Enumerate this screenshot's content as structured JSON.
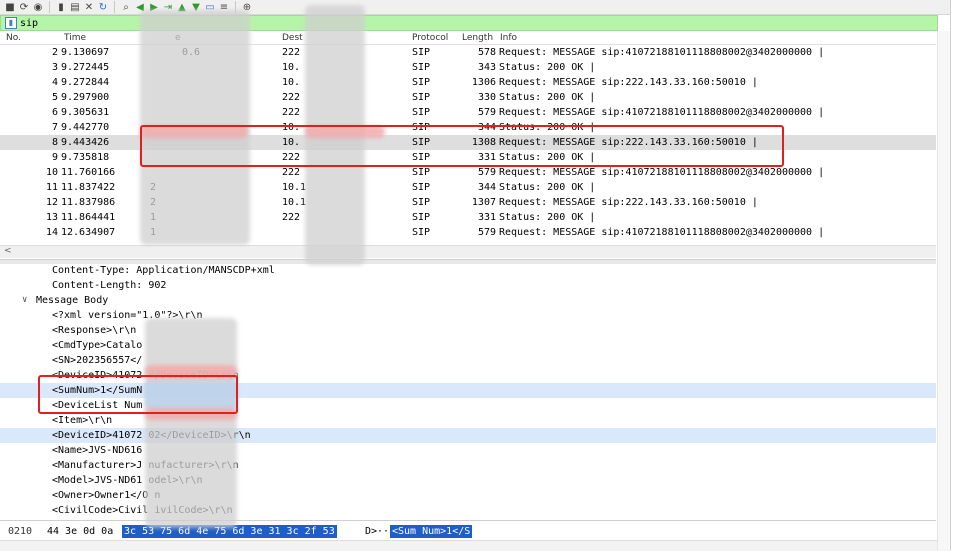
{
  "toolbar": {
    "icons": [
      "stop-icon",
      "restart-icon",
      "options-icon",
      "open-icon",
      "save-icon",
      "close-file-icon",
      "reload-icon",
      "find-icon",
      "back-icon",
      "forward-icon",
      "goto-icon",
      "first-icon",
      "last-icon",
      "autoscroll-icon",
      "colorize-icon",
      "zoom-in-icon"
    ]
  },
  "filter": {
    "value": "sip"
  },
  "columns": {
    "no": "No.",
    "time": "Time",
    "source": "e",
    "destination": "Dest",
    "protocol": "Protocol",
    "length": "Length",
    "info": "Info"
  },
  "packets": [
    {
      "no": "2",
      "time": "9.130697",
      "src": "0.6",
      "dst": "222",
      "proto": "SIP",
      "len": "578",
      "info": "Request: MESSAGE sip:41072188101118808002@3402000000 |"
    },
    {
      "no": "3",
      "time": "9.272445",
      "src": "",
      "dst": "10.",
      "proto": "SIP",
      "len": "343",
      "info": "Status: 200 OK |"
    },
    {
      "no": "4",
      "time": "9.272844",
      "src": "",
      "dst": "10.",
      "proto": "SIP",
      "len": "1306",
      "info": "Request: MESSAGE sip:222.143.33.160:50010 |"
    },
    {
      "no": "5",
      "time": "9.297900",
      "src": "",
      "dst": "222",
      "proto": "SIP",
      "len": "330",
      "info": "Status: 200 OK |"
    },
    {
      "no": "6",
      "time": "9.305631",
      "src": "",
      "dst": "222",
      "proto": "SIP",
      "len": "579",
      "info": "Request: MESSAGE sip:41072188101118808002@3402000000 |"
    },
    {
      "no": "7",
      "time": "9.442770",
      "src": "",
      "dst": "10.",
      "proto": "SIP",
      "len": "344",
      "info": "Status: 200 OK |"
    },
    {
      "no": "8",
      "time": "9.443426",
      "src": "",
      "dst": "10.",
      "proto": "SIP",
      "len": "1308",
      "info": "Request: MESSAGE sip:222.143.33.160:50010 |"
    },
    {
      "no": "9",
      "time": "9.735818",
      "src": "",
      "dst": "222",
      "proto": "SIP",
      "len": "331",
      "info": "Status: 200 OK |"
    },
    {
      "no": "10",
      "time": "11.760166",
      "src": "",
      "dst": "222",
      "proto": "SIP",
      "len": "579",
      "info": "Request: MESSAGE sip:41072188101118808002@3402000000 |"
    },
    {
      "no": "11",
      "time": "11.837422",
      "src": "2",
      "dst": "10.1",
      "proto": "SIP",
      "len": "344",
      "info": "Status: 200 OK |"
    },
    {
      "no": "12",
      "time": "11.837986",
      "src": "2",
      "dst": "10.1",
      "proto": "SIP",
      "len": "1307",
      "info": "Request: MESSAGE sip:222.143.33.160:50010 |"
    },
    {
      "no": "13",
      "time": "11.864441",
      "src": "1",
      "dst": "222",
      "proto": "SIP",
      "len": "331",
      "info": "Status: 200 OK |"
    },
    {
      "no": "14",
      "time": "12.634907",
      "src": "1",
      "dst": "",
      "proto": "SIP",
      "len": "579",
      "info": "Request: MESSAGE sip:41072188101118808002@3402000000 |"
    }
  ],
  "details": [
    {
      "indent": "    ",
      "text": "Content-Type: Application/MANSCDP+xml"
    },
    {
      "indent": "    ",
      "text": "Content-Length: 902"
    },
    {
      "indent": "",
      "text": "Message Body",
      "toggle": "∨"
    },
    {
      "indent": "    ",
      "text": "<?xml version=\"1.0\"?>\\r\\n"
    },
    {
      "indent": "    ",
      "text": "<Response>\\r\\n"
    },
    {
      "indent": "    ",
      "text": "<CmdType>Catalo"
    },
    {
      "indent": "    ",
      "text": "<SN>202356557</"
    },
    {
      "indent": "    ",
      "text": "<DeviceID>41072                  </DeviceID>\\r\\n"
    },
    {
      "indent": "    ",
      "text": "<SumNum>1</SumN"
    },
    {
      "indent": "    ",
      "text": "<DeviceList Num"
    },
    {
      "indent": "    ",
      "text": "<Item>\\r\\n"
    },
    {
      "indent": "    ",
      "text": "<DeviceID>41072              02</DeviceID>\\r\\n"
    },
    {
      "indent": "    ",
      "text": "<Name>JVS-ND616"
    },
    {
      "indent": "    ",
      "text": "<Manufacturer>J         nufacturer>\\r\\n"
    },
    {
      "indent": "    ",
      "text": "<Model>JVS-ND61              odel>\\r\\n"
    },
    {
      "indent": "    ",
      "text": "<Owner>Owner1</O            n"
    },
    {
      "indent": "    ",
      "text": "<CivilCode>Civil        ivilCode>\\r\\n"
    }
  ],
  "bytes": {
    "offset": "0210",
    "hex_plain": "44 3e 0d 0a",
    "hex_selected": "3c 53 75 6d  4e 75 6d 3e 31 3c 2f 53",
    "ascii_plain": "D>··",
    "ascii_selected": "<Sum Num>1</S"
  }
}
